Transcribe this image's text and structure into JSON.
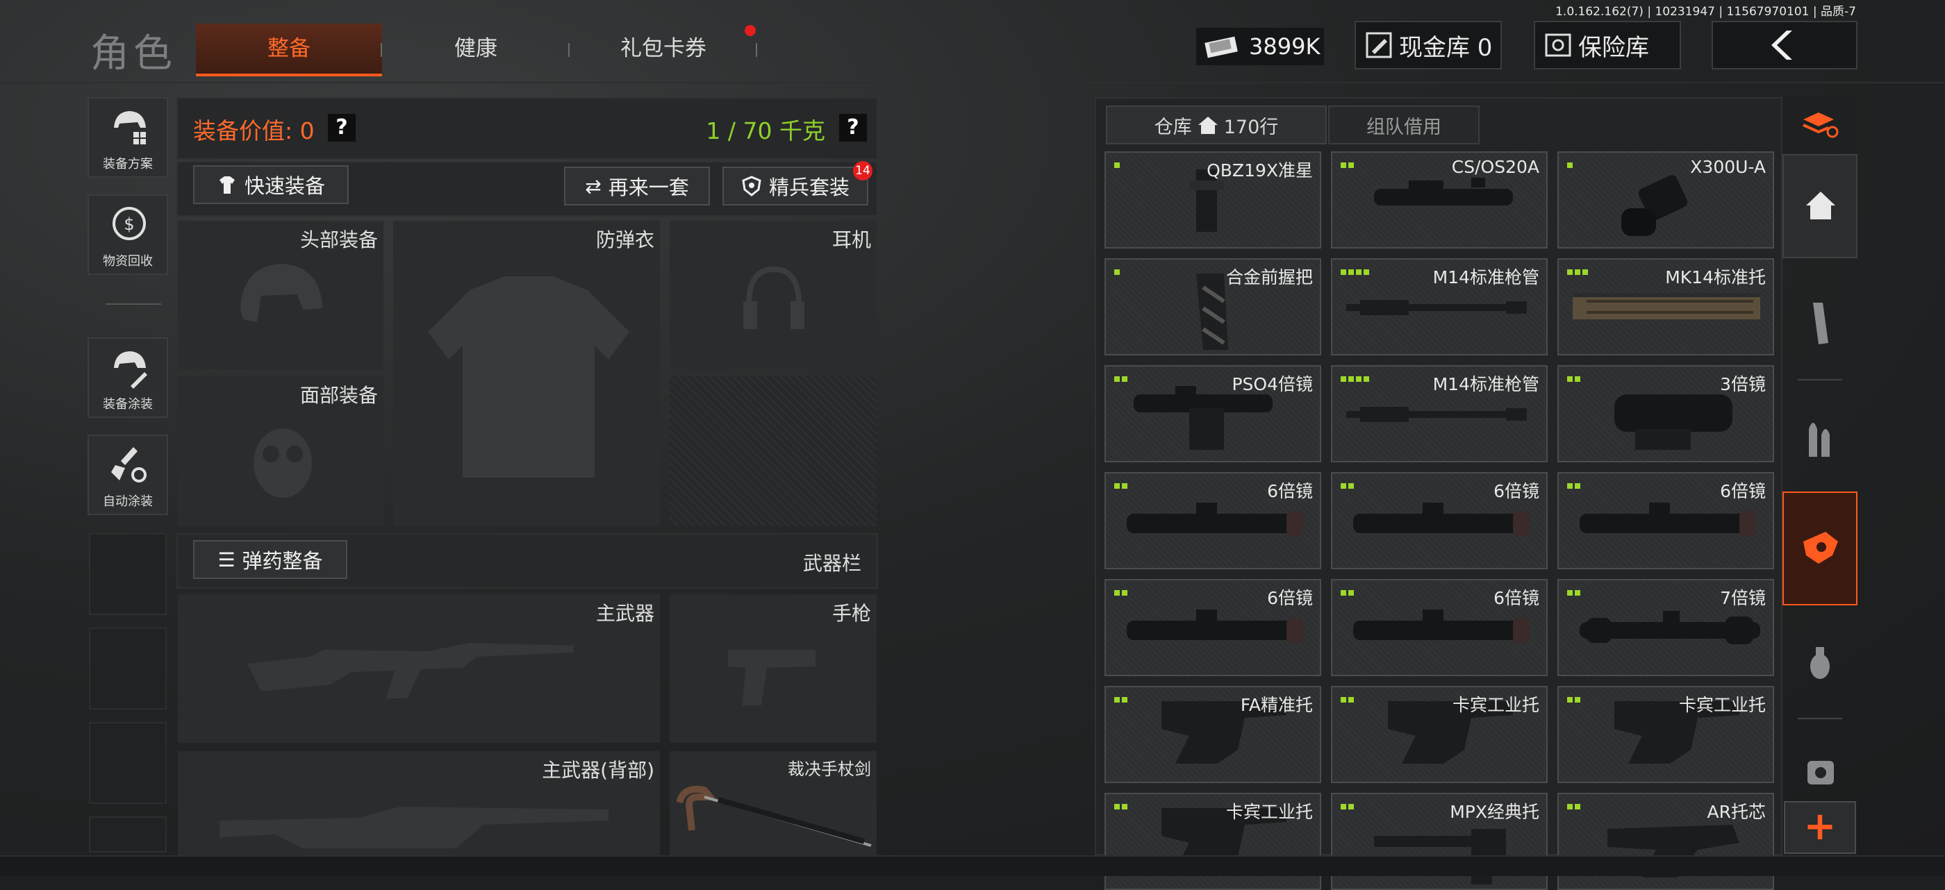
{
  "version_text": "1.0.162.162(7) | 10231947 | 11567970101 | 品质-7",
  "header": {
    "title": "角色",
    "tabs": [
      {
        "label": "整备",
        "active": true
      },
      {
        "label": "健康"
      },
      {
        "label": "礼包卡券",
        "has_dot": true
      }
    ],
    "money": "3899K",
    "cash_vault": "现金库 0",
    "safe_label": "保险库"
  },
  "sidebar": [
    {
      "label": "装备方案",
      "icon": "helmet-plan-icon"
    },
    {
      "label": "物资回收",
      "icon": "recycle-icon"
    },
    {
      "label": "装备涂装",
      "icon": "paint-helmet-icon"
    },
    {
      "label": "自动涂装",
      "icon": "auto-brush-icon"
    }
  ],
  "loadout": {
    "value_label": "装备价值: 0",
    "weight_label": "1 / 70 千克",
    "help": "?",
    "quick_equip": "快速装备",
    "again": "再来一套",
    "elite": "精兵套装",
    "elite_badge": "14",
    "slots": {
      "head": "头部装备",
      "armor": "防弹衣",
      "ear": "耳机",
      "face": "面部装备",
      "ammo_btn": "弹药整备",
      "weapon_bar": "武器栏",
      "primary": "主武器",
      "pistol": "手枪",
      "primary_back": "主武器(背部)",
      "melee": "裁决手杖剑"
    }
  },
  "inventory": {
    "tab_warehouse": "仓库",
    "rows": "170行",
    "tab_team": "组队借用",
    "items": [
      {
        "name": "QBZ19X准星",
        "dots": 1,
        "art": "sight"
      },
      {
        "name": "CS/OS20A",
        "dots": 2,
        "art": "scope"
      },
      {
        "name": "X300U-A",
        "dots": 1,
        "art": "light"
      },
      {
        "name": "合金前握把",
        "dots": 1,
        "art": "grip"
      },
      {
        "name": "M14标准枪管",
        "dots": 4,
        "art": "barrel"
      },
      {
        "name": "MK14标准托",
        "dots": 3,
        "art": "rail"
      },
      {
        "name": "PSO4倍镜",
        "dots": 2,
        "art": "pso"
      },
      {
        "name": "M14标准枪管",
        "dots": 4,
        "art": "barrel"
      },
      {
        "name": "3倍镜",
        "dots": 2,
        "art": "acog"
      },
      {
        "name": "6倍镜",
        "dots": 2,
        "art": "scope6"
      },
      {
        "name": "6倍镜",
        "dots": 2,
        "art": "scope6"
      },
      {
        "name": "6倍镜",
        "dots": 2,
        "art": "scope6"
      },
      {
        "name": "6倍镜",
        "dots": 2,
        "art": "scope6"
      },
      {
        "name": "6倍镜",
        "dots": 2,
        "art": "scope6"
      },
      {
        "name": "7倍镜",
        "dots": 2,
        "art": "scope7"
      },
      {
        "name": "FA精准托",
        "dots": 2,
        "art": "stock"
      },
      {
        "name": "卡宾工业托",
        "dots": 2,
        "art": "stock"
      },
      {
        "name": "卡宾工业托",
        "dots": 2,
        "art": "stock"
      },
      {
        "name": "卡宾工业托",
        "dots": 2,
        "art": "stock"
      },
      {
        "name": "MPX经典托",
        "dots": 2,
        "art": "stock2"
      },
      {
        "name": "AR托芯",
        "dots": 2,
        "art": "stock3"
      }
    ]
  },
  "rail": [
    "filter-layers-icon",
    "home-icon",
    "magazine-icon",
    "ammo-icon",
    "sight-category-icon",
    "grenade-icon",
    "misc-icon"
  ],
  "add_label": "+",
  "colors": {
    "accent": "#ff5a1f",
    "green": "#9ed82a",
    "weight_green": "#8fd12a"
  }
}
